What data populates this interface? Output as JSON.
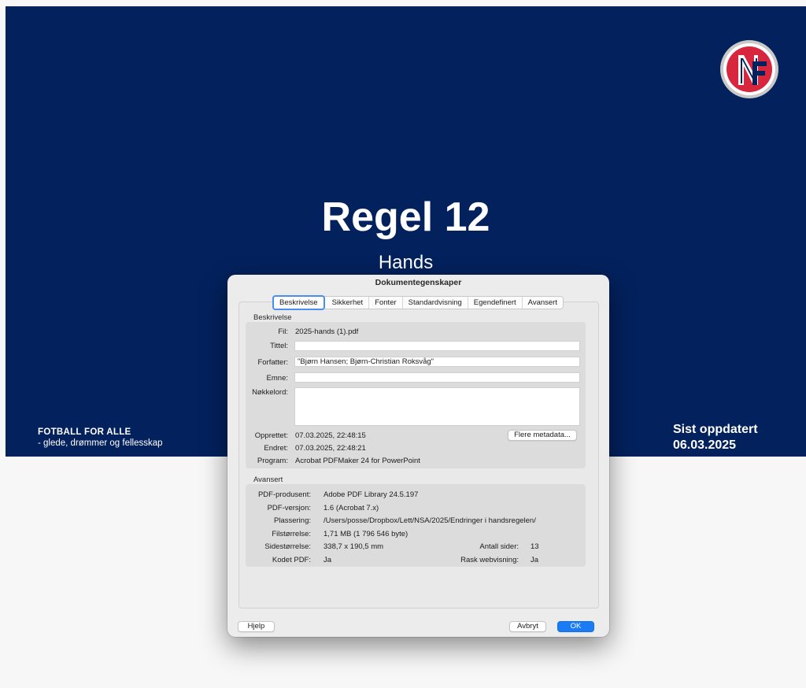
{
  "slide": {
    "title": "Regel 12",
    "subtitle": "Hands",
    "slogan_line1": "FOTBALL FOR ALLE",
    "slogan_line2": "- glede, drømmer og fellesskap",
    "updated_label": "Sist oppdatert",
    "updated_date": "06.03.2025",
    "logo": {
      "icon": "nff-logo",
      "letters": "NFF",
      "year": "1902",
      "ring_text": "NORGES FOTBALLFORBUND"
    },
    "colors": {
      "background": "#03215d",
      "page": "#f7f7f7"
    }
  },
  "dialog": {
    "title": "Dokumentegenskaper",
    "tabs": [
      "Beskrivelse",
      "Sikkerhet",
      "Fonter",
      "Standardvisning",
      "Egendefinert",
      "Avansert"
    ],
    "active_tab": "Beskrivelse",
    "description": {
      "section_label": "Beskrivelse",
      "file_label": "Fil:",
      "file_value": "2025-hands (1).pdf",
      "title_label": "Tittel:",
      "title_value": "",
      "author_label": "Forfatter:",
      "author_value": "\"Bjørn Hansen; Bjørn-Christian Roksvåg\"",
      "subject_label": "Emne:",
      "subject_value": "",
      "keywords_label": "Nøkkelord:",
      "keywords_value": "",
      "created_label": "Opprettet:",
      "created_value": "07.03.2025, 22:48:15",
      "modified_label": "Endret:",
      "modified_value": "07.03.2025, 22:48:21",
      "program_label": "Program:",
      "program_value": "Acrobat PDFMaker 24 for PowerPoint",
      "more_metadata_button": "Flere metadata..."
    },
    "advanced": {
      "section_label": "Avansert",
      "producer_label": "PDF-produsent:",
      "producer_value": "Adobe PDF Library 24.5.197",
      "version_label": "PDF-versjon:",
      "version_value": "1.6 (Acrobat 7.x)",
      "location_label": "Plassering:",
      "location_value": "/Users/posse/Dropbox/Lett/NSA/2025/Endringer i handsregelen/",
      "filesize_label": "Filstørrelse:",
      "filesize_value": "1,71 MB (1 796 546 byte)",
      "pagesize_label": "Sidestørrelse:",
      "pagesize_value": "338,7 x 190,5 mm",
      "pages_label": "Antall sider:",
      "pages_value": "13",
      "tagged_label": "Kodet PDF:",
      "tagged_value": "Ja",
      "fastweb_label": "Rask webvisning:",
      "fastweb_value": "Ja"
    },
    "buttons": {
      "help": "Hjelp",
      "cancel": "Avbryt",
      "ok": "OK"
    },
    "colors": {
      "accent": "#1a7cf5",
      "tab_focus": "#4a8ef2"
    }
  }
}
